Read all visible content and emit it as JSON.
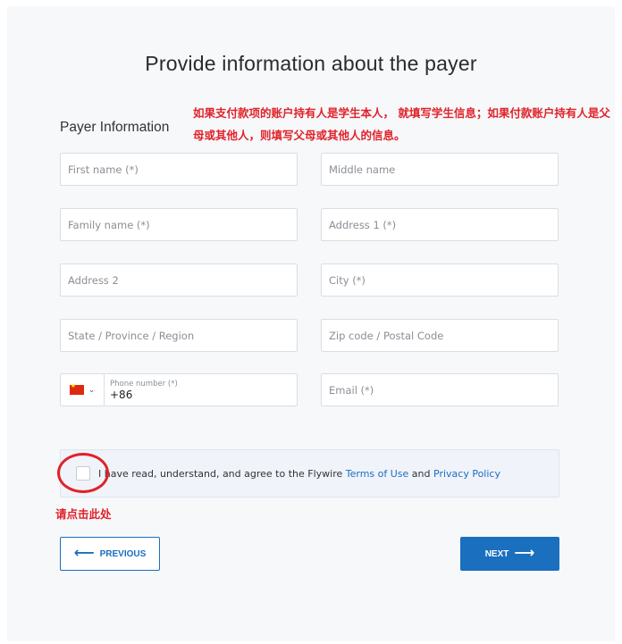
{
  "page": {
    "title": "Provide information about the payer",
    "annotation_note": "如果支付款项的账户持有人是学生本人， 就填写学生信息；如果付款账户持有人是父母或其他人，则填写父母或其他人的信息。",
    "section_label": "Payer Information",
    "click_here_note": "请点击此处"
  },
  "fields": {
    "first_name": "First name (*)",
    "middle_name": "Middle name",
    "family_name": "Family name (*)",
    "address1": "Address 1 (*)",
    "address2": "Address 2",
    "city": "City (*)",
    "state": "State / Province / Region",
    "zip": "Zip code / Postal Code",
    "phone_label": "Phone number (*)",
    "phone_value": "+86",
    "email": "Email (*)"
  },
  "terms": {
    "prefix": "I have read, understand, and agree to the Flywire ",
    "terms_link": "Terms of Use",
    "and": " and ",
    "privacy_link": "Privacy Policy"
  },
  "buttons": {
    "previous": "PREVIOUS",
    "next": "NEXT"
  },
  "colors": {
    "primary": "#1a6fbf",
    "annotation_red": "#e0222a"
  }
}
